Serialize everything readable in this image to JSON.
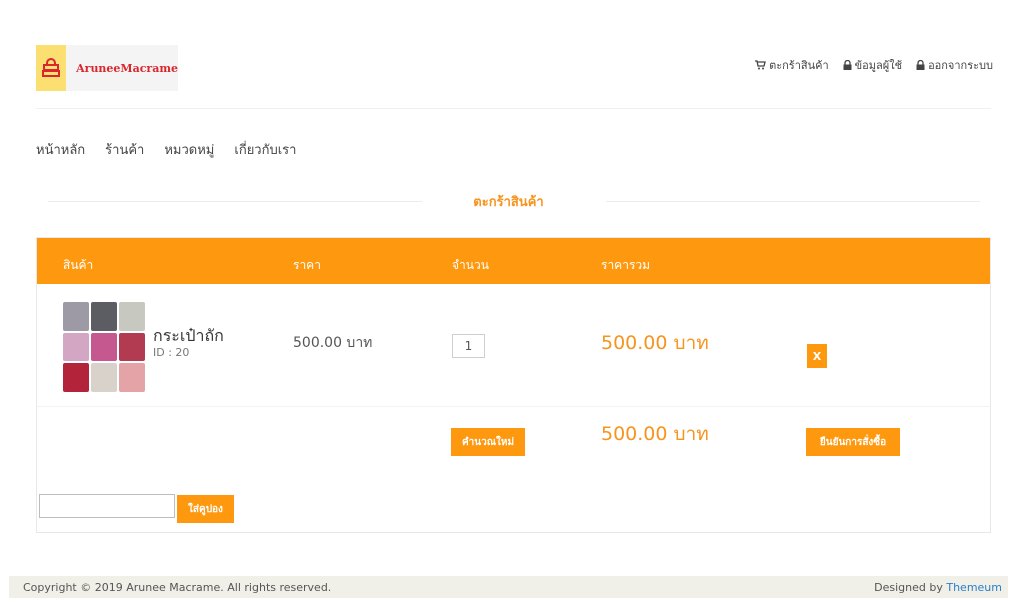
{
  "brand": {
    "name": "AruneeMacrame",
    "accent": "#fe980f",
    "logo_bg": "#fbe071",
    "logo_text_color": "#d9262f"
  },
  "topnav": {
    "cart": "ตะกร้าสินค้า",
    "profile": "ข้อมูลผู้ใช้",
    "logout": "ออกจากระบบ"
  },
  "mainnav": [
    "หน้าหลัก",
    "ร้านค้า",
    "หมวดหมู่",
    "เกี่ยวกับเรา"
  ],
  "section_title": "ตะกร้าสินค้า",
  "cart": {
    "headers": {
      "product": "สินค้า",
      "price": "ราคา",
      "qty": "จำนวน",
      "total": "ราคารวม"
    },
    "items": [
      {
        "name": "กระเป๋าถัก",
        "id_text": "ID : 20",
        "price": "500.00 บาท",
        "qty": "1",
        "total": "500.00 บาท",
        "remove_label": "X"
      }
    ],
    "update_label": "คำนวณใหม่",
    "grand_total": "500.00 บาท",
    "confirm_label": "ยืนยันการสั่งซื้อ",
    "coupon_value": "",
    "coupon_button": "ใส่คูปอง"
  },
  "footer": {
    "copyright": "Copyright © 2019 Arunee Macrame. All rights reserved.",
    "designed_by": "Designed by",
    "designer": "Themeum"
  }
}
